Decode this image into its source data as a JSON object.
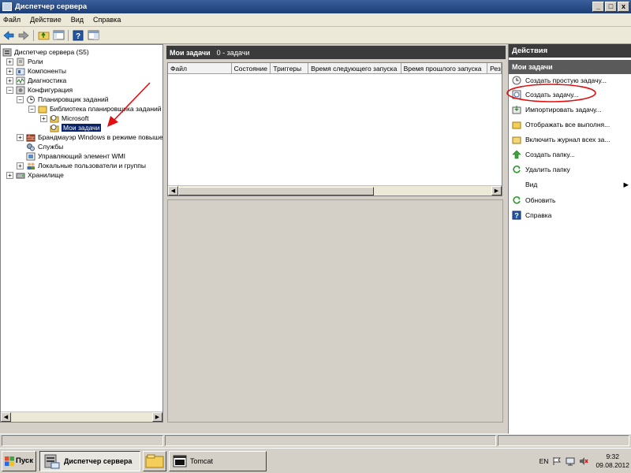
{
  "window": {
    "title": "Диспетчер сервера",
    "btn_min": "_",
    "btn_max": "□",
    "btn_close": "x"
  },
  "menu": [
    "Файл",
    "Действие",
    "Вид",
    "Справка"
  ],
  "tree": {
    "root": "Диспетчер сервера (S5)",
    "roles": "Роли",
    "components": "Компоненты",
    "diagnostics": "Диагностика",
    "configuration": "Конфигурация",
    "scheduler": "Планировщик заданий",
    "library": "Библиотека планировщика заданий",
    "microsoft": "Microsoft",
    "my_tasks": "Мои задачи",
    "firewall": "Брандмауэр Windows в режиме повыше",
    "services": "Службы",
    "wmi": "Управляющий элемент WMI",
    "users": "Локальные пользователи и группы",
    "storage": "Хранилище",
    "expander_collapsed": "+",
    "expander_expanded": "−"
  },
  "center": {
    "title": "Мои задачи",
    "count": "0 - задачи",
    "columns": [
      "Файл",
      "Состояние",
      "Триггеры",
      "Время следующего запуска",
      "Время прошлого запуска",
      "Рез"
    ]
  },
  "actions": {
    "header": "Действия",
    "section": "Мои задачи",
    "items": [
      "Создать простую задачу...",
      "Создать задачу...",
      "Импортировать задачу...",
      "Отображать все выполня...",
      "Включить журнал всех за...",
      "Создать папку...",
      "Удалить папку",
      "Вид",
      "Обновить",
      "Справка"
    ],
    "submenu_arrow": "▶"
  },
  "taskbar": {
    "start": "Пуск",
    "tasks": [
      "Диспетчер сервера",
      "Tomcat"
    ],
    "lang": "EN",
    "time": "9:32",
    "date": "09.08.2012"
  },
  "colors": {
    "title_bar": "#1c3d78",
    "selection": "#0a246a",
    "pane_header": "#3b3b3b",
    "annotation": "#e01010"
  }
}
